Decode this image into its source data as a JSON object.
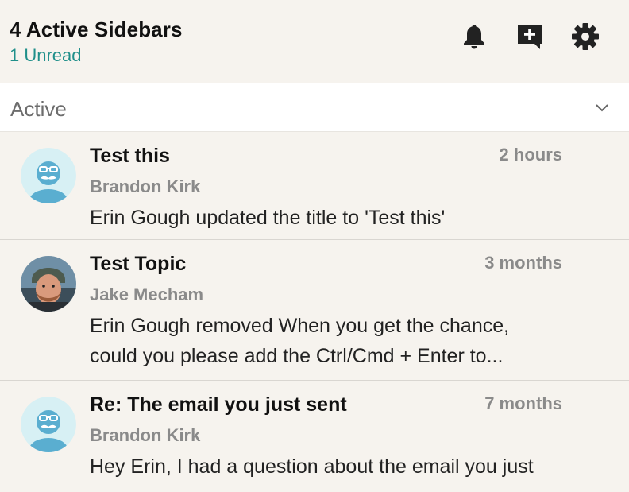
{
  "header": {
    "title": "4 Active Sidebars",
    "unread": "1 Unread",
    "icons": [
      "bell-icon",
      "new-message-icon",
      "gear-icon"
    ]
  },
  "filter": {
    "selected": "Active"
  },
  "items": [
    {
      "title": "Test this",
      "time": "2 hours",
      "author": "Brandon Kirk",
      "excerpt_lines": [
        "Erin Gough updated the title to 'Test this'"
      ],
      "avatar": "mustache-avatar"
    },
    {
      "title": "Test Topic",
      "time": "3 months",
      "author": "Jake Mecham",
      "excerpt_lines": [
        "Erin Gough removed When you get the chance,",
        "could you please add the Ctrl/Cmd + Enter to..."
      ],
      "avatar": "photo-avatar"
    },
    {
      "title": "Re: The email you just sent",
      "time": "7 months",
      "author": "Brandon Kirk",
      "excerpt_lines": [
        "Hey Erin, I had a question about the email you just"
      ],
      "avatar": "mustache-avatar"
    }
  ],
  "colors": {
    "accent": "#1f8f8a",
    "background": "#f6f3ee",
    "muted_text": "#8a8a8a",
    "avatar_bg": "#d7f0f4",
    "avatar_fg": "#5aaed0"
  }
}
